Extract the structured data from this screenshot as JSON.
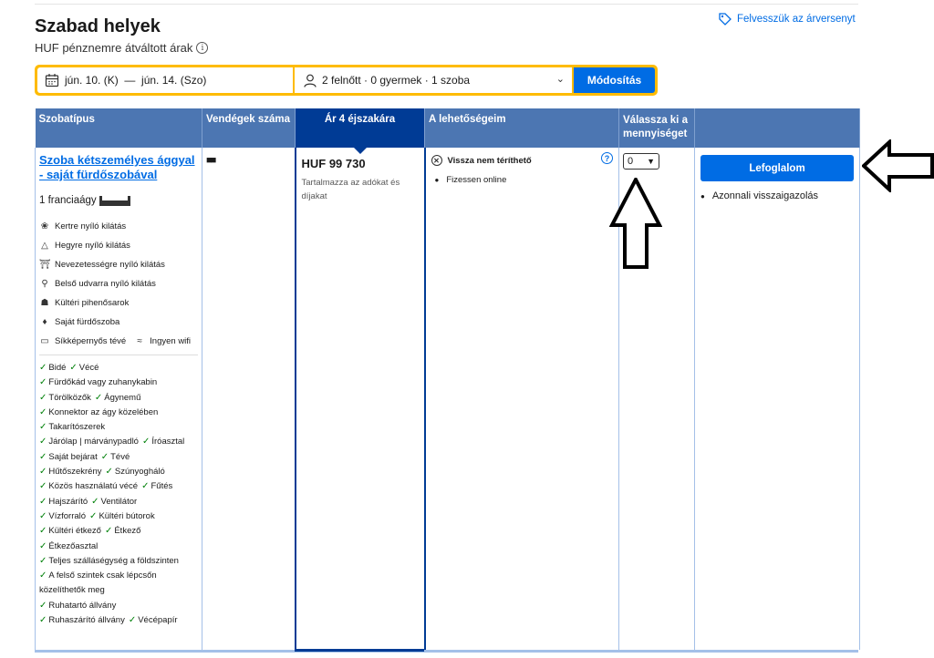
{
  "header": {
    "title": "Szabad helyek",
    "subtitle": "HUF pénznemre átváltott árak",
    "price_match": "Felvesszük az árversenyt"
  },
  "search": {
    "dates": "jún. 10. (K)  —  jún. 14. (Szo)",
    "guests": "2 felnőtt · 0 gyermek · 1 szoba",
    "button": "Módosítás"
  },
  "table": {
    "headers": {
      "room_type": "Szobatípus",
      "guests": "Vendégek száma",
      "price": "Ár 4 éjszakára",
      "options": "A lehetőségeim",
      "quantity": "Válassza ki a mennyiséget"
    },
    "room": {
      "name": "Szoba kétszemélyes ággyal - saját fürdőszobával",
      "bed": "1 franciaágy",
      "features": [
        {
          "icon": "garden-view-icon",
          "label": "Kertre nyíló kilátás"
        },
        {
          "icon": "mountain-view-icon",
          "label": "Hegyre nyíló kilátás"
        },
        {
          "icon": "landmark-view-icon",
          "label": "Nevezetességre nyíló kilátás"
        },
        {
          "icon": "courtyard-view-icon",
          "label": "Belső udvarra nyíló kilátás"
        },
        {
          "icon": "terrace-icon",
          "label": "Kültéri pihenősarok"
        },
        {
          "icon": "shower-icon",
          "label": "Saját fürdőszoba"
        }
      ],
      "tv": "Síkképernyős tévé",
      "wifi": "Ingyen wifi",
      "amenities": [
        [
          "Bidé",
          "Vécé"
        ],
        [
          "Fürdőkád vagy zuhanykabin"
        ],
        [
          "Törölközők",
          "Ágynemű"
        ],
        [
          "Konnektor az ágy közelében"
        ],
        [
          "Takarítószerek"
        ],
        [
          "Járólap | márványpadló",
          "Íróasztal"
        ],
        [
          "Saját bejárat",
          "Tévé"
        ],
        [
          "Hűtőszekrény",
          "Szúnyogháló"
        ],
        [
          "Közös használatú vécé",
          "Fűtés"
        ],
        [
          "Hajszárító",
          "Ventilátor"
        ],
        [
          "Vízforraló",
          "Kültéri bútorok"
        ],
        [
          "Kültéri étkező",
          "Étkező"
        ],
        [
          "Étkezőasztal"
        ],
        [
          "Teljes szálláségység a földszinten"
        ],
        [
          "A felső szintek csak lépcsőn közelíthetők meg"
        ],
        [
          "Ruhatartó állvány"
        ],
        [
          "Ruhaszárító állvány",
          "Vécépapír"
        ]
      ],
      "price": "HUF 99 730",
      "price_note": "Tartalmazza az adókat és díjakat",
      "option_title": "Vissza nem téríthető",
      "option_pay": "Fizessen online",
      "quantity_value": "0",
      "book_button": "Lefoglalom",
      "confirmation": "Azonnali visszaigazolás"
    }
  }
}
